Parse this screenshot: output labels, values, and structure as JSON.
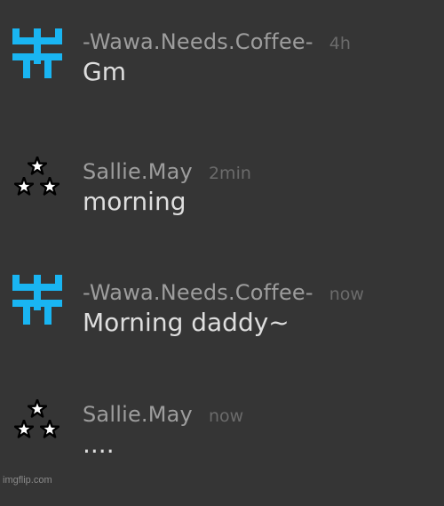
{
  "messages": [
    {
      "author": "-Wawa.Needs.Coffee-",
      "time": "4h",
      "text": "Gm",
      "avatar_icon": "cyan-glyph-icon",
      "avatar_color": "#19b5f2"
    },
    {
      "author": "Sallie.May",
      "time": "2min",
      "text": "morning",
      "avatar_icon": "three-stars-icon"
    },
    {
      "author": "-Wawa.Needs.Coffee-",
      "time": "now",
      "text": "Morning daddy~",
      "avatar_icon": "cyan-glyph-icon",
      "avatar_color": "#19b5f2"
    },
    {
      "author": "Sallie.May",
      "time": "now",
      "text": "....",
      "avatar_icon": "three-stars-icon"
    }
  ],
  "watermark": "imgflip.com",
  "colors": {
    "background": "#353535",
    "author": "#9d9d9d",
    "timestamp": "#6b6b6b",
    "message_text": "#dedede"
  }
}
